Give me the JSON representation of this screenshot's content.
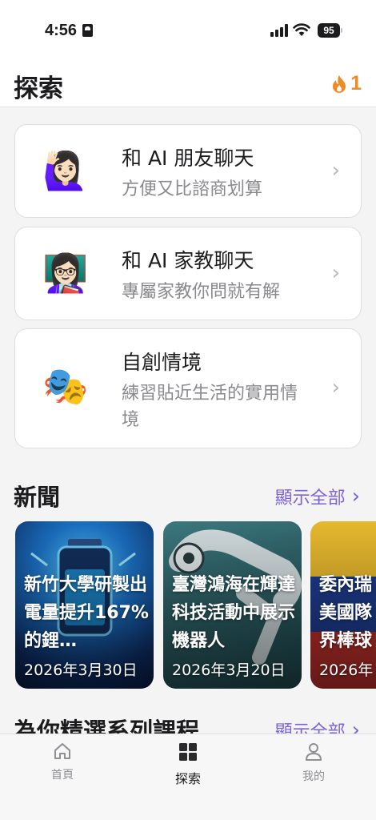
{
  "status_bar": {
    "time": "4:56",
    "battery": "95"
  },
  "header": {
    "title": "探索",
    "streak_count": "1"
  },
  "cards": [
    {
      "emoji": "🙋🏻‍♀️",
      "title": "和 AI 朋友聊天",
      "subtitle": "方便又比諮商划算"
    },
    {
      "emoji": "👩🏻‍🏫",
      "title": "和 AI 家教聊天",
      "subtitle": "專屬家教你問就有解"
    },
    {
      "emoji": "🎭",
      "title": "自創情境",
      "subtitle": "練習貼近生活的實用情境"
    }
  ],
  "news": {
    "section_title": "新聞",
    "show_all": "顯示全部",
    "items": [
      {
        "title": "新竹大學研製出電量提升167%的鋰…",
        "date": "2026年3月30日"
      },
      {
        "title": "臺灣鴻海在輝達科技活動中展示機器人",
        "date": "2026年3月20日"
      },
      {
        "title": "委內瑞美國隊界棒球",
        "date": "2026年"
      }
    ]
  },
  "courses": {
    "section_title": "為你精選系列課程",
    "show_all": "顯示全部"
  },
  "tab_bar": {
    "tabs": [
      {
        "label": "首頁",
        "icon": "home-icon"
      },
      {
        "label": "探索",
        "icon": "grid-icon"
      },
      {
        "label": "我的",
        "icon": "person-icon"
      }
    ]
  },
  "colors": {
    "accent": "#7b63d9",
    "streak": "#f08a24",
    "background": "#f4f4f4"
  }
}
